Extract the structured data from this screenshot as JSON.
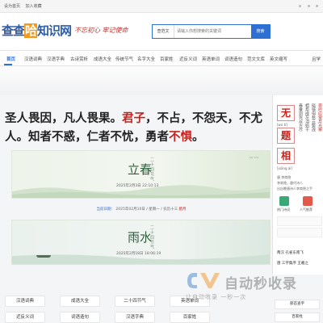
{
  "topbar": {
    "left_1": "设为首页",
    "left_2": "加入收藏"
  },
  "header": {
    "logo_pre": "查查",
    "logo_hi": "哈",
    "logo_post": "知识网",
    "slogan": "不忘初心 牢记使命",
    "search_select": "查范文",
    "search_placeholder": "请输入你想搜索的关键词",
    "search_button": "搜索"
  },
  "nav": [
    "首页",
    "汉语词典",
    "汉语字典",
    "古诗赏析",
    "成语大全",
    "传统节气",
    "名字大全",
    "百家姓",
    "近反义词",
    "英语单词",
    "词语造句",
    "范文文库",
    "英文缩写"
  ],
  "nav_right": "且学",
  "poem": {
    "p1": "圣人畏因，凡人畏果。",
    "p2": "君子",
    "p3": "，不占，不怨天，不尤人。知者不惑，仁者不忧，勇者",
    "p4": "不惧",
    "p5": "。"
  },
  "solar_terms": [
    {
      "name": "立春",
      "vertical": "二十四节气",
      "date": "2025年2月3日 22:10:13"
    },
    {
      "name": "雨水",
      "vertical": "二十四节气",
      "date": "2025年2月18日 18:06:19"
    }
  ],
  "calendar": {
    "link": "当前日期：",
    "text": "2025年02月10日 / 星期一 / 农历十三",
    "highlight": "腊月"
  },
  "sidebar": {
    "word": [
      "无",
      "题",
      "相"
    ],
    "pinyin_1": "[wú tí]",
    "pinyin_2": "[xiāng ài]",
    "col_a": "春蚕到死丝方尽",
    "col_b": "蜡炬成灰泪始干",
    "col_c": "晓镜但愁云鬓改",
    "col_d": "夜吟应觉月光寒",
    "author_label": "唐 李商隐",
    "author_line": "李商隐，唐代诗人",
    "note": "出自晚唐诗人李商隐之手",
    "label_1": "热门诗词",
    "label_2": "人气推荐",
    "row_1": "两汉  孔雀东南飞",
    "row_2": "唐  三字集序  王羲之",
    "bottom_1": "部首查字",
    "bottom_2": "百家姓"
  },
  "grid": [
    "汉语词典",
    "成语大全",
    "二十四节气",
    "英语单词",
    "近反义词",
    "词语造句",
    "汉语字典",
    "百家姓"
  ],
  "watermark": {
    "title": "自动秒收录",
    "sub": "让自动收录 一秒一次"
  },
  "colors": {
    "accent": "#2d6fd3",
    "red": "#c3241f",
    "logo": "#2d5ca8"
  }
}
